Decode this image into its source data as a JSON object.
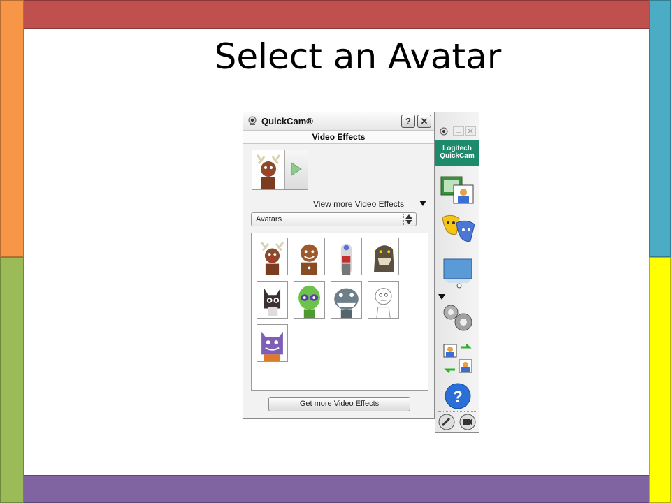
{
  "slide": {
    "title": "Select an Avatar",
    "colors": {
      "top_bar": "#c0504d",
      "bottom_bar": "#8064a2",
      "left_top": "#f79646",
      "left_bottom": "#9bbb59",
      "right_top": "#4bacc6",
      "right_bottom": "#ffff00"
    }
  },
  "window": {
    "title": "QuickCam®",
    "help_label": "?",
    "close_label": "✕",
    "section_title": "Video Effects",
    "view_more_label": "View more Video Effects",
    "dropdown_value": "Avatars",
    "get_more_label": "Get more Video Effects",
    "avatars": [
      {
        "name": "reindeer",
        "icon": "reindeer-avatar"
      },
      {
        "name": "gingerbread",
        "icon": "gingerbread-avatar"
      },
      {
        "name": "sock-puppet",
        "icon": "sock-puppet-avatar"
      },
      {
        "name": "dinosaur",
        "icon": "dinosaur-avatar"
      },
      {
        "name": "cat",
        "icon": "cat-avatar"
      },
      {
        "name": "alien",
        "icon": "alien-avatar"
      },
      {
        "name": "shark",
        "icon": "shark-avatar"
      },
      {
        "name": "sketch",
        "icon": "sketch-avatar"
      },
      {
        "name": "monster",
        "icon": "monster-avatar"
      }
    ]
  },
  "sidebar": {
    "brand_line1": "Logitech",
    "brand_line2": "QuickCam",
    "icons": [
      "capture-icon",
      "video-effects-icon",
      "screen-icon",
      "settings-icon",
      "video-call-icon",
      "help-icon"
    ]
  }
}
